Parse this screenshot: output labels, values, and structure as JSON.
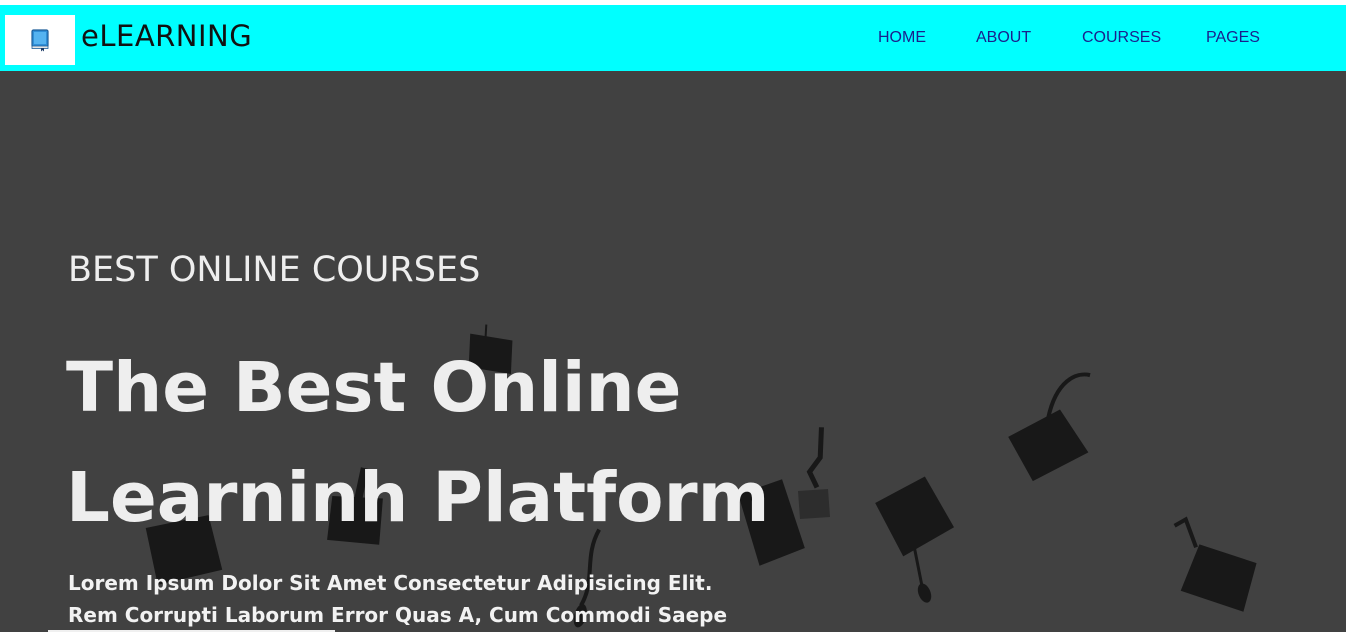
{
  "brand": {
    "name": "eLEARNING",
    "logo_icon": "book-icon"
  },
  "nav": {
    "items": [
      {
        "label": "HOME"
      },
      {
        "label": "ABOUT"
      },
      {
        "label": "COURSES"
      },
      {
        "label": "PAGES"
      }
    ]
  },
  "hero": {
    "kicker": "BEST ONLINE COURSES",
    "title_line_1": "The Best Online",
    "title_line_2": "Learninh Platform",
    "desc_line_1": "Lorem Ipsum Dolor Sit Amet Consectetur Adipisicing Elit.",
    "desc_line_2": "Rem Corrupti Laborum Error Quas A, Cum Commodi Saepe",
    "background_image": "graduation-caps-in-air"
  },
  "colors": {
    "navbar_bg": "#00ffff",
    "nav_link": "#1a1f8c",
    "hero_bg": "#414141",
    "hero_text": "#eeeeee"
  }
}
